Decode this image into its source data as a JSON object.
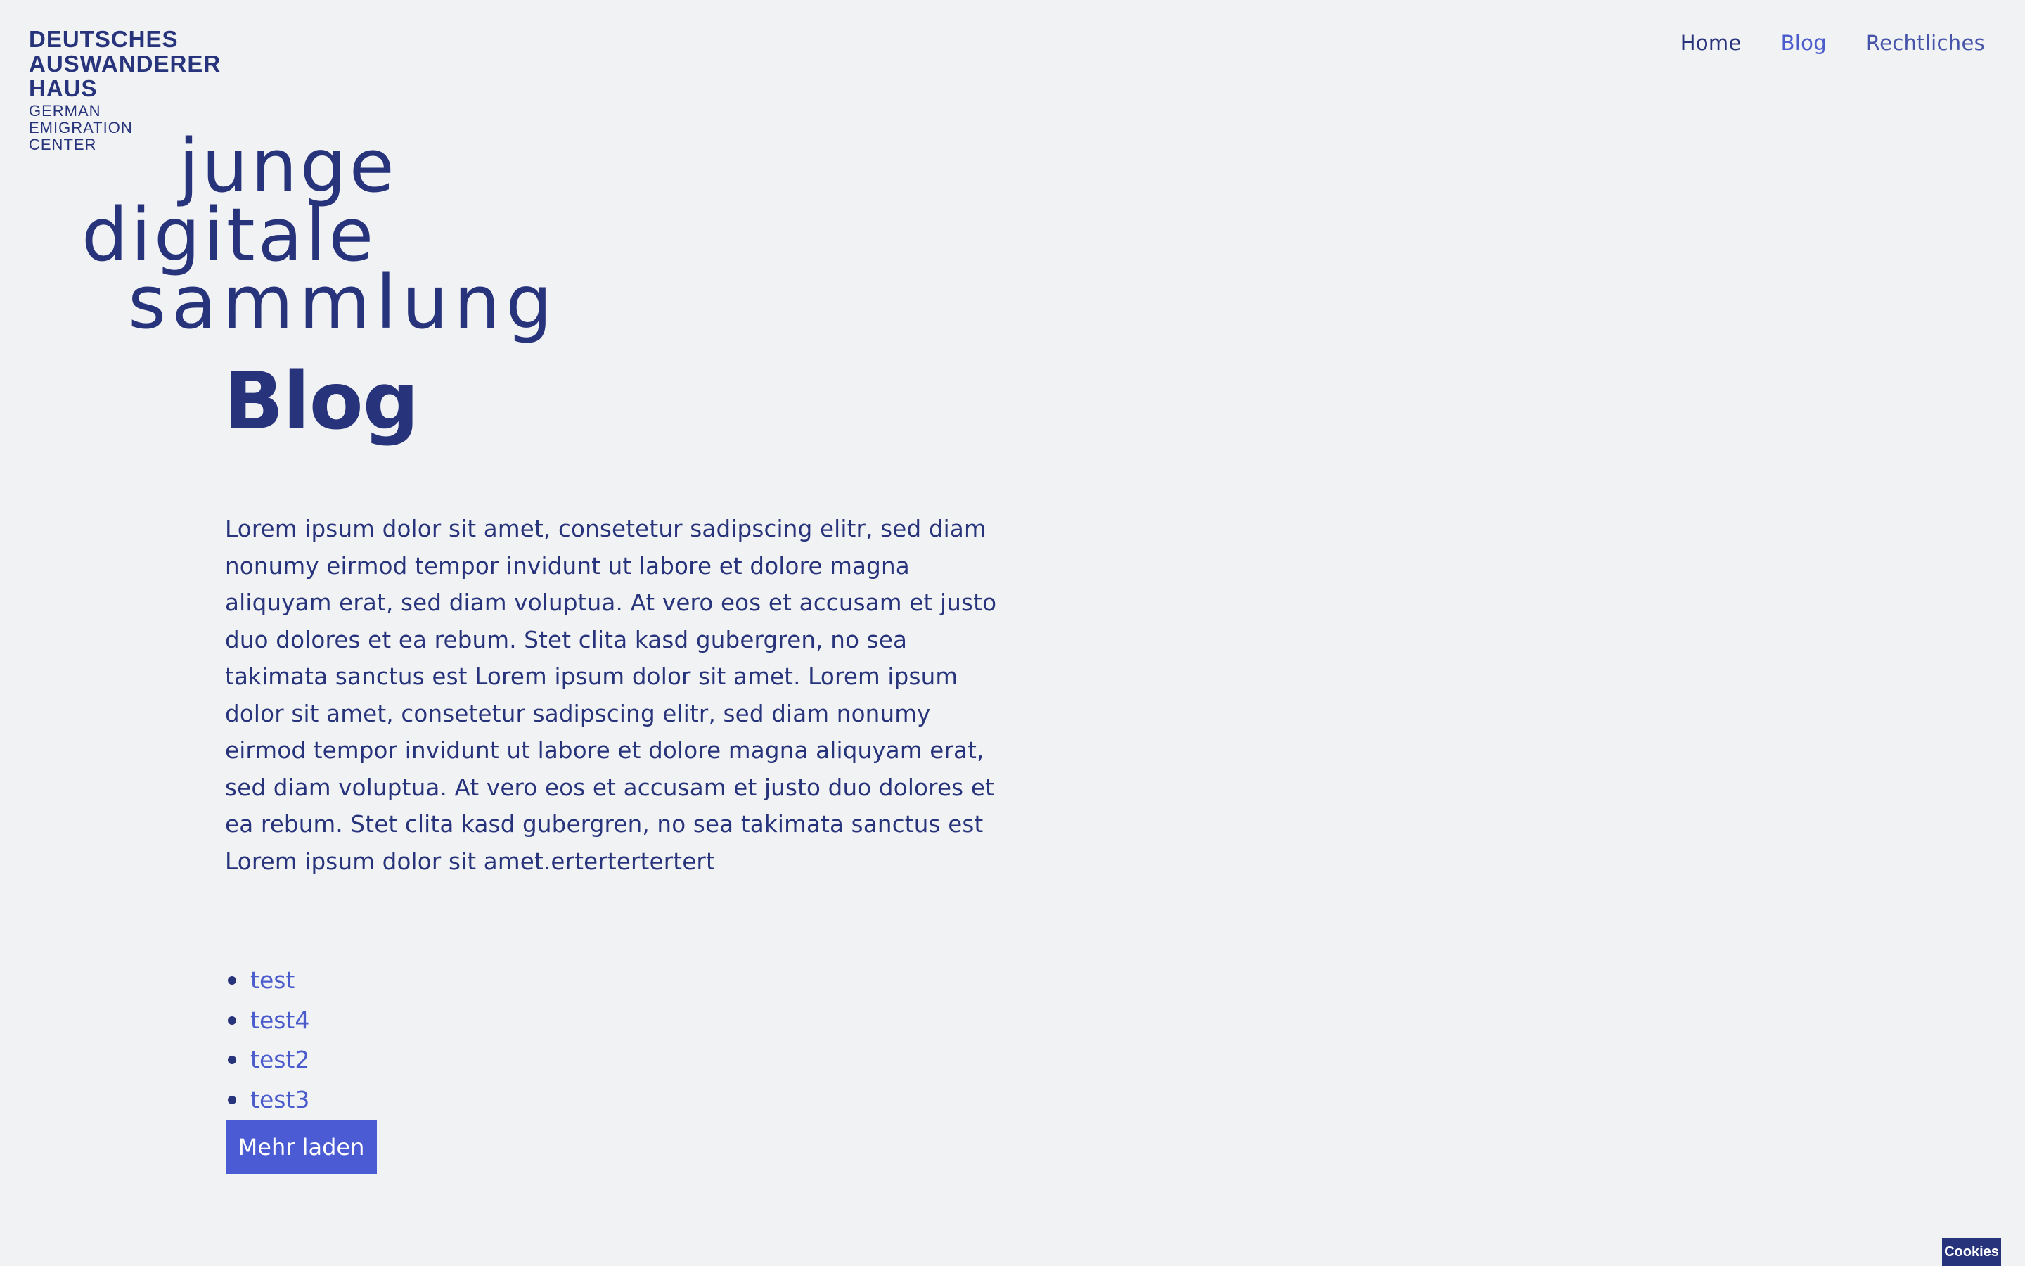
{
  "logo": {
    "main_lines": [
      "DEUTSCHES",
      "AUSWANDERER",
      "HAUS"
    ],
    "sub_lines": [
      "GERMAN",
      "EMIGRATION",
      "CENTER"
    ]
  },
  "nav": {
    "items": [
      {
        "label": "Home"
      },
      {
        "label": "Blog"
      },
      {
        "label": "Rechtliches"
      }
    ]
  },
  "site_title": {
    "lines": [
      "junge",
      "digitale",
      "sammlung"
    ]
  },
  "page": {
    "heading": "Blog",
    "intro": "Lorem ipsum dolor sit amet, consetetur sadipscing elitr, sed diam nonumy eirmod tempor invidunt ut labore et dolore magna aliquyam erat, sed diam voluptua. At vero eos et accusam et justo duo dolores et ea rebum. Stet clita kasd gubergren, no sea takimata sanctus est Lorem ipsum dolor sit amet. Lorem ipsum dolor sit amet, consetetur sadipscing elitr, sed diam nonumy eirmod tempor invidunt ut labore et dolore magna aliquyam erat, sed diam voluptua. At vero eos et accusam et justo duo dolores et ea rebum. Stet clita kasd gubergren, no sea takimata sanctus est Lorem ipsum dolor sit amet.ertertertertert"
  },
  "posts": [
    {
      "title": "test"
    },
    {
      "title": "test4"
    },
    {
      "title": "test2"
    },
    {
      "title": "test3"
    }
  ],
  "load_more_label": "Mehr laden",
  "cookies_label": "Cookies",
  "colors": {
    "background": "#f1f2f4",
    "primary": "#27337a",
    "accent": "#4a5bd3"
  }
}
